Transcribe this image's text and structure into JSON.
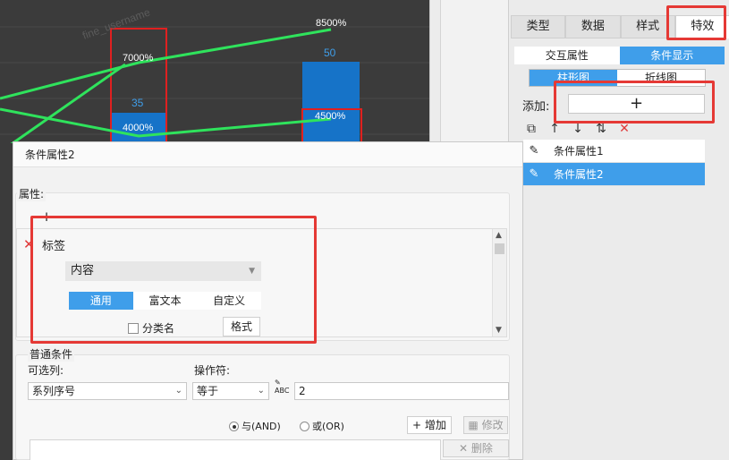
{
  "chart": {
    "bar_labels": [
      "35",
      "50"
    ],
    "point_labels": [
      "7000%",
      "4000%",
      "8500%",
      "4500%"
    ],
    "watermark": "fine_username"
  },
  "right_panel": {
    "tabs": [
      "类型",
      "数据",
      "样式",
      "特效"
    ],
    "active_tab": "特效",
    "sub_tabs": [
      "交互属性",
      "条件显示"
    ],
    "chart_tabs": [
      "柱形图",
      "折线图"
    ],
    "add_label": "添加:",
    "add_button": "+",
    "toolbar": [
      "copy-icon",
      "up-arrow-icon",
      "down-arrow-icon",
      "move-icon",
      "delete-icon"
    ],
    "conditions": [
      "条件属性1",
      "条件属性2"
    ]
  },
  "dialog": {
    "title": "条件属性2",
    "properties_group": "属性:",
    "add_icon": "+",
    "property": {
      "label": "标签",
      "content_select": "内容",
      "segments": [
        "通用",
        "富文本",
        "自定义"
      ],
      "category_checkbox": "分类名",
      "format_button": "格式"
    },
    "condition_group": "普通条件",
    "optional_label": "可选列:",
    "operator_label": "操作符:",
    "optional_value": "系列序号",
    "operator_value": "等于",
    "value": "2",
    "and_label": "与(AND)",
    "or_label": "或(OR)",
    "add_btn": "增加",
    "edit_btn": "修改",
    "delete_btn": "删除"
  },
  "colors": {
    "accent": "#3f9eea",
    "highlight": "#e53935",
    "chart_bg": "#3b3b3b",
    "line_green": "#2fe35c"
  }
}
